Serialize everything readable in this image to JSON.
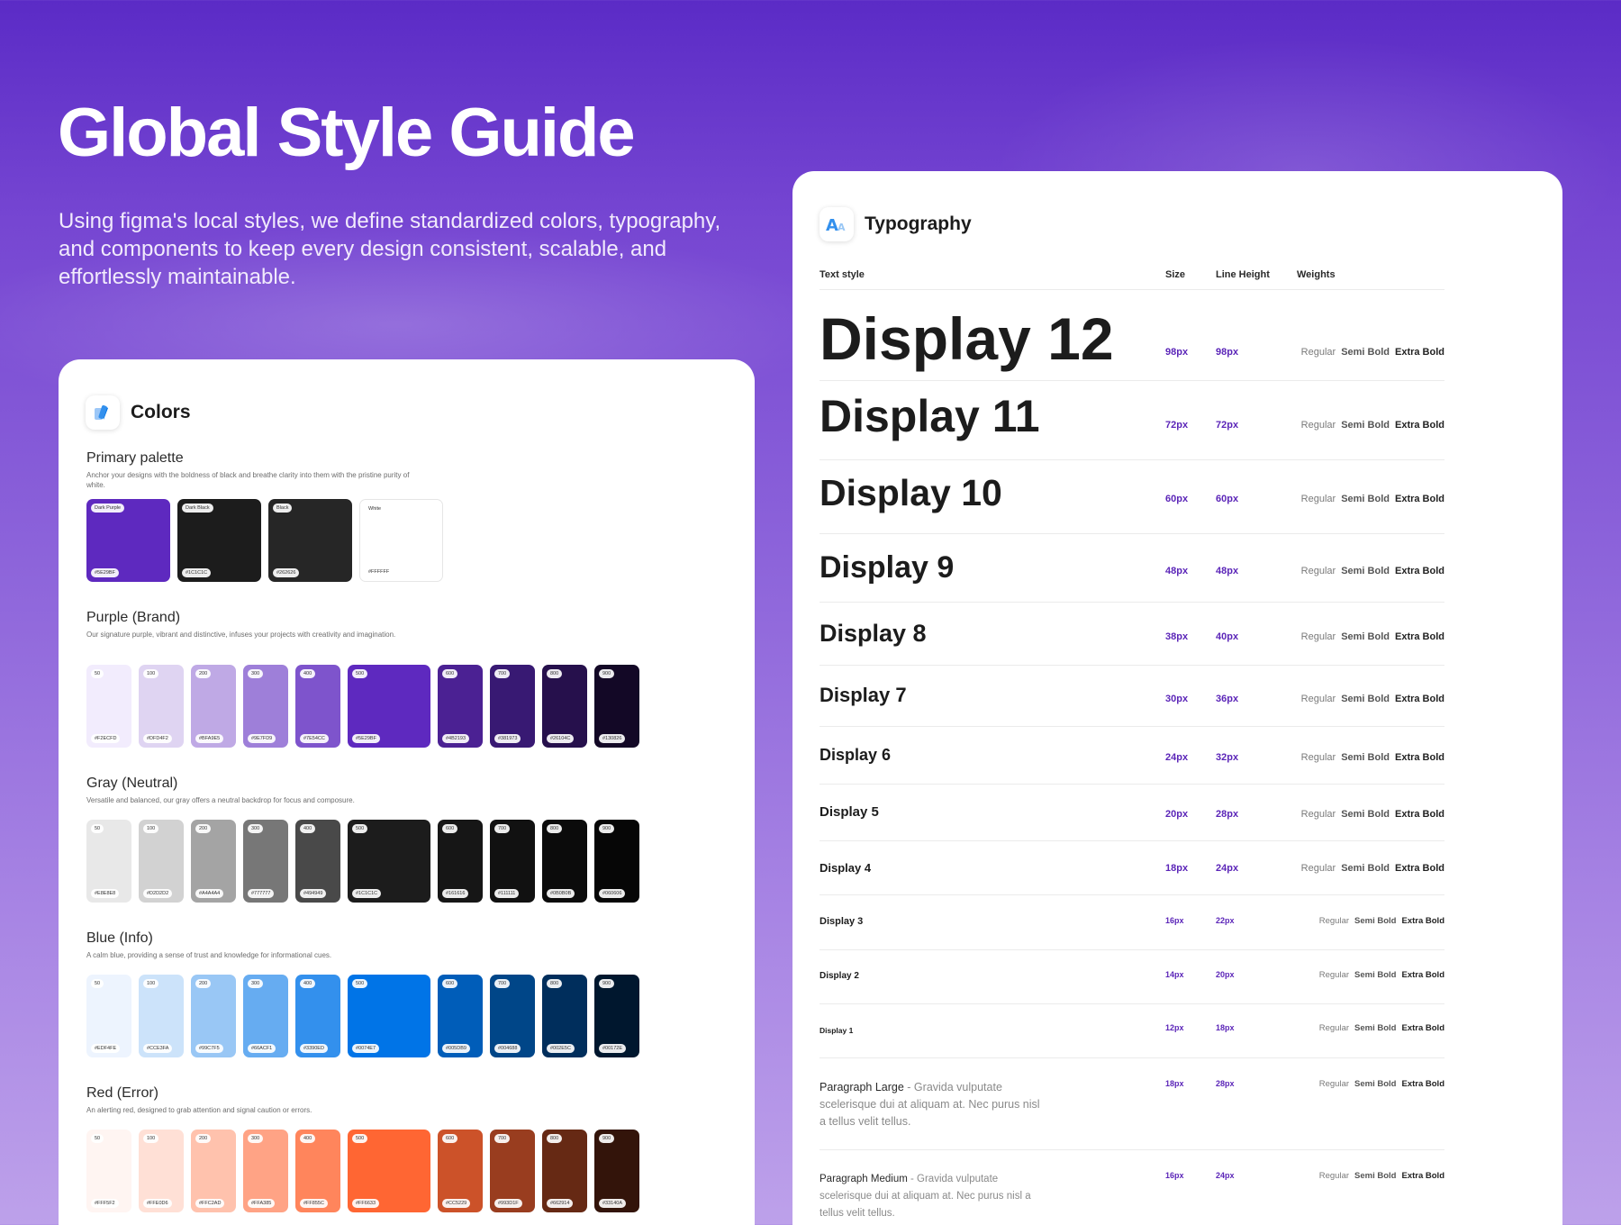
{
  "hero": {
    "title": "Global Style Guide",
    "subtitle": "Using figma's local styles, we define standardized colors, typography, and components to keep every design consistent, scalable, and effortlessly maintainable."
  },
  "colors": {
    "title": "Colors",
    "primary": {
      "title": "Primary palette",
      "desc": "Anchor your designs with the boldness of black and breathe clarity into them with the pristine purity of white.",
      "swatches": [
        {
          "name": "Dark Purple",
          "hex": "#5E29BF",
          "color": "#5e29bf"
        },
        {
          "name": "Dark Black",
          "hex": "#1C1C1C",
          "color": "#1c1c1c"
        },
        {
          "name": "Black",
          "hex": "#262626",
          "color": "#262626"
        },
        {
          "name": "White",
          "hex": "#FFFFFF",
          "color": "#ffffff"
        }
      ]
    },
    "purple": {
      "title": "Purple (Brand)",
      "desc": "Our signature purple, vibrant and distinctive, infuses your projects with creativity and imagination.",
      "swatches": [
        {
          "step": "50",
          "hex": "#F2ECFD",
          "color": "#f2ecfd"
        },
        {
          "step": "100",
          "hex": "#DFD4F2",
          "color": "#dfd4f2"
        },
        {
          "step": "200",
          "hex": "#BFA9E5",
          "color": "#bfa9e5"
        },
        {
          "step": "300",
          "hex": "#9E7FD9",
          "color": "#9e7fd9"
        },
        {
          "step": "400",
          "hex": "#7E54CC",
          "color": "#7e54cc"
        },
        {
          "step": "500",
          "hex": "#5E29BF",
          "color": "#5e29bf"
        },
        {
          "step": "600",
          "hex": "#4B2193",
          "color": "#4b2193"
        },
        {
          "step": "700",
          "hex": "#381973",
          "color": "#381973"
        },
        {
          "step": "800",
          "hex": "#26104C",
          "color": "#26104c"
        },
        {
          "step": "900",
          "hex": "#130826",
          "color": "#130826"
        }
      ]
    },
    "gray": {
      "title": "Gray (Neutral)",
      "desc": "Versatile and balanced, our gray offers a neutral backdrop for focus and composure.",
      "swatches": [
        {
          "step": "50",
          "hex": "#E8E8E8",
          "color": "#e8e8e8"
        },
        {
          "step": "100",
          "hex": "#D2D2D2",
          "color": "#d2d2d2"
        },
        {
          "step": "200",
          "hex": "#A4A4A4",
          "color": "#a4a4a4"
        },
        {
          "step": "300",
          "hex": "#777777",
          "color": "#777777"
        },
        {
          "step": "400",
          "hex": "#494949",
          "color": "#494949"
        },
        {
          "step": "500",
          "hex": "#1C1C1C",
          "color": "#1c1c1c"
        },
        {
          "step": "600",
          "hex": "#161616",
          "color": "#161616"
        },
        {
          "step": "700",
          "hex": "#111111",
          "color": "#111111"
        },
        {
          "step": "800",
          "hex": "#0B0B0B",
          "color": "#0b0b0b"
        },
        {
          "step": "900",
          "hex": "#060606",
          "color": "#060606"
        }
      ]
    },
    "blue": {
      "title": "Blue (Info)",
      "desc": "A calm blue, providing a sense of trust and knowledge for informational cues.",
      "swatches": [
        {
          "step": "50",
          "hex": "#EDF4FE",
          "color": "#edf4fe"
        },
        {
          "step": "100",
          "hex": "#CCE3FA",
          "color": "#cce3fa"
        },
        {
          "step": "200",
          "hex": "#99C7F5",
          "color": "#99c7f5"
        },
        {
          "step": "300",
          "hex": "#66ACF1",
          "color": "#66acf1"
        },
        {
          "step": "400",
          "hex": "#3390ED",
          "color": "#3390ed"
        },
        {
          "step": "500",
          "hex": "#0074E7",
          "color": "#0074e7"
        },
        {
          "step": "600",
          "hex": "#005DB9",
          "color": "#005db9"
        },
        {
          "step": "700",
          "hex": "#004688",
          "color": "#004688"
        },
        {
          "step": "800",
          "hex": "#002E5C",
          "color": "#002e5c"
        },
        {
          "step": "900",
          "hex": "#00172E",
          "color": "#00172e"
        }
      ]
    },
    "red": {
      "title": "Red (Error)",
      "desc": "An alerting red, designed to grab attention and signal caution or errors.",
      "swatches": [
        {
          "step": "50",
          "hex": "#FFF5F2",
          "color": "#fff5f2"
        },
        {
          "step": "100",
          "hex": "#FFE0D6",
          "color": "#ffe0d6"
        },
        {
          "step": "200",
          "hex": "#FFC2AD",
          "color": "#ffc2ad"
        },
        {
          "step": "300",
          "hex": "#FFA385",
          "color": "#ffa385"
        },
        {
          "step": "400",
          "hex": "#FF855C",
          "color": "#ff855c"
        },
        {
          "step": "500",
          "hex": "#FF6633",
          "color": "#ff6633"
        },
        {
          "step": "600",
          "hex": "#CC5229",
          "color": "#cc5229"
        },
        {
          "step": "700",
          "hex": "#993D1F",
          "color": "#993d1f"
        },
        {
          "step": "800",
          "hex": "#662914",
          "color": "#662914"
        },
        {
          "step": "900",
          "hex": "#33140A",
          "color": "#33140a"
        }
      ]
    }
  },
  "typography": {
    "title": "Typography",
    "headers": {
      "style": "Text style",
      "size": "Size",
      "line_height": "Line Height",
      "weights": "Weights"
    },
    "weights": {
      "regular": "Regular",
      "semi": "Semi Bold",
      "extra": "Extra Bold"
    },
    "rows": [
      {
        "name": "Display 12",
        "size": "98px",
        "lh": "98px"
      },
      {
        "name": "Display 11",
        "size": "72px",
        "lh": "72px"
      },
      {
        "name": "Display 10",
        "size": "60px",
        "lh": "60px"
      },
      {
        "name": "Display 9",
        "size": "48px",
        "lh": "48px"
      },
      {
        "name": "Display 8",
        "size": "38px",
        "lh": "40px"
      },
      {
        "name": "Display 7",
        "size": "30px",
        "lh": "36px"
      },
      {
        "name": "Display 6",
        "size": "24px",
        "lh": "32px"
      },
      {
        "name": "Display 5",
        "size": "20px",
        "lh": "28px"
      },
      {
        "name": "Display 4",
        "size": "18px",
        "lh": "24px"
      },
      {
        "name": "Display 3",
        "size": "16px",
        "lh": "22px"
      },
      {
        "name": "Display 2",
        "size": "14px",
        "lh": "20px"
      },
      {
        "name": "Display 1",
        "size": "12px",
        "lh": "18px"
      }
    ],
    "paragraphs": [
      {
        "name": "Paragraph Large",
        "text": " - Gravida vulputate scelerisque dui at aliquam at. Nec purus nisl a tellus velit tellus.",
        "size": "18px",
        "lh": "28px"
      },
      {
        "name": "Paragraph Medium",
        "text": " - Gravida vulputate scelerisque dui at aliquam at. Nec purus nisl a tellus velit tellus.",
        "size": "16px",
        "lh": "24px"
      }
    ]
  }
}
